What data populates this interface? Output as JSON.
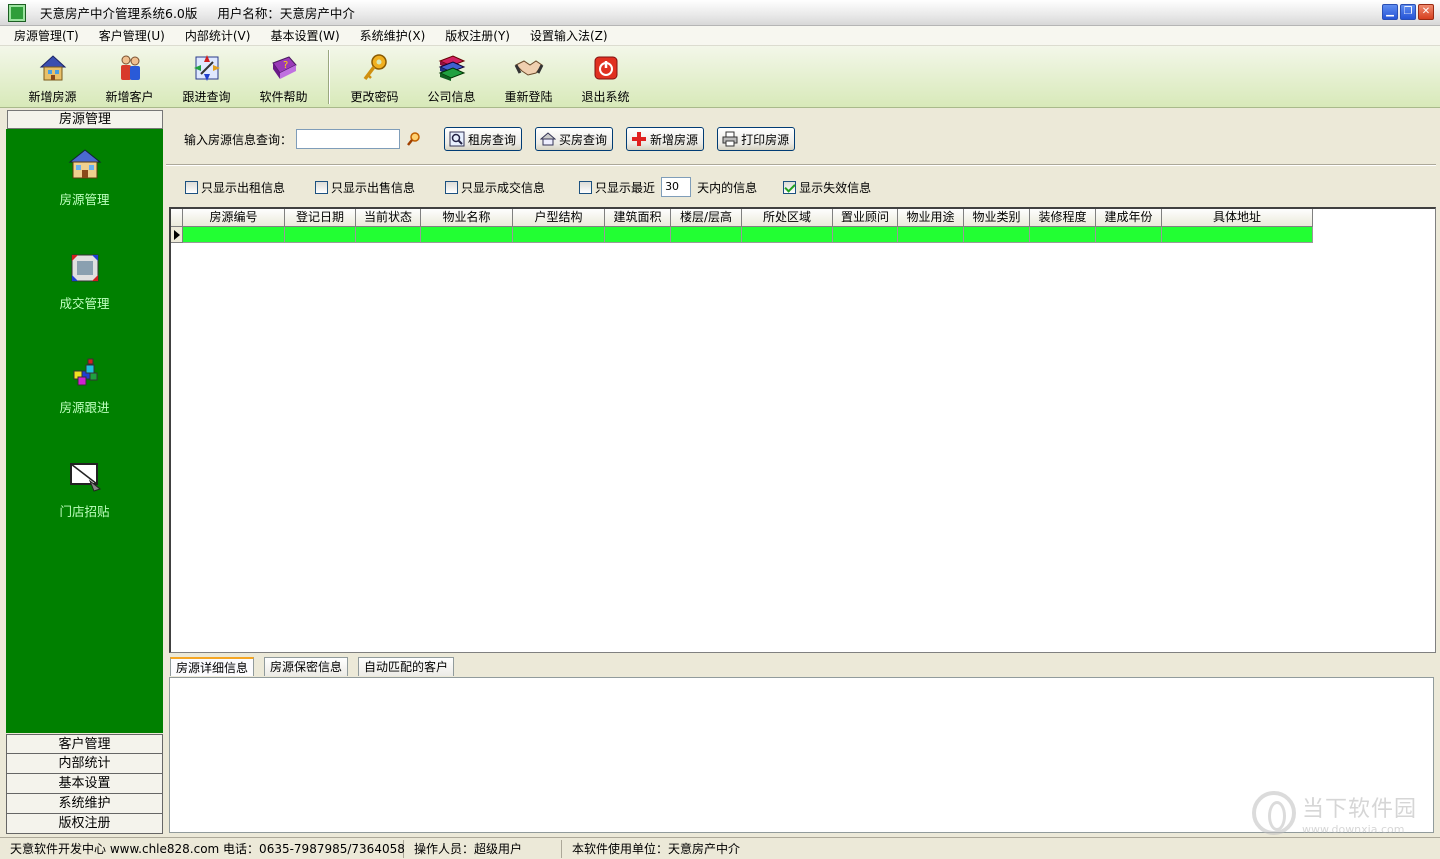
{
  "window": {
    "title": "天意房产中介管理系统6.0版",
    "user": "用户名称：天意房产中介"
  },
  "menu": [
    "房源管理(T)",
    "客户管理(U)",
    "内部统计(V)",
    "基本设置(W)",
    "系统维护(X)",
    "版权注册(Y)",
    "设置输入法(Z)"
  ],
  "toolbar": {
    "new_listing": "新增房源",
    "new_customer": "新增客户",
    "follow_query": "跟进查询",
    "help": "软件帮助",
    "change_password": "更改密码",
    "company_info": "公司信息",
    "relogin": "重新登陆",
    "exit": "退出系统"
  },
  "sidebar": {
    "header": "房源管理",
    "items": [
      "房源管理",
      "成交管理",
      "房源跟进",
      "门店招贴"
    ],
    "bottom": [
      "客户管理",
      "内部统计",
      "基本设置",
      "系统维护",
      "版权注册"
    ]
  },
  "search": {
    "label": "输入房源信息查询：",
    "value": "",
    "rent_query": "租房查询",
    "buy_query": "买房查询",
    "add_listing": "新增房源",
    "print_listing": "打印房源"
  },
  "filters": {
    "rent_only": "只显示出租信息",
    "sale_only": "只显示出售信息",
    "deal_only": "只显示成交信息",
    "recent_prefix": "只显示最近",
    "recent_days": "30",
    "recent_suffix": "天内的信息",
    "show_invalid": "显示失效信息",
    "rent_only_checked": false,
    "sale_only_checked": false,
    "deal_only_checked": false,
    "recent_checked": false,
    "show_invalid_checked": true
  },
  "grid": {
    "columns": [
      "房源编号",
      "登记日期",
      "当前状态",
      "物业名称",
      "户型结构",
      "建筑面积",
      "楼层/层高",
      "所处区域",
      "置业顾问",
      "物业用途",
      "物业类别",
      "装修程度",
      "建成年份",
      "具体地址"
    ],
    "row_color": "#22ff33"
  },
  "tabs": [
    "房源详细信息",
    "房源保密信息",
    "自动匹配的客户"
  ],
  "status": {
    "developer": "天意软件开发中心 www.chle828.com 电话：0635-7987985/7364058",
    "operator": "操作人员：超级用户",
    "unit": "本软件使用单位：天意房产中介"
  },
  "watermark": {
    "name": "当下软件园",
    "url": "www.downxia.com"
  }
}
